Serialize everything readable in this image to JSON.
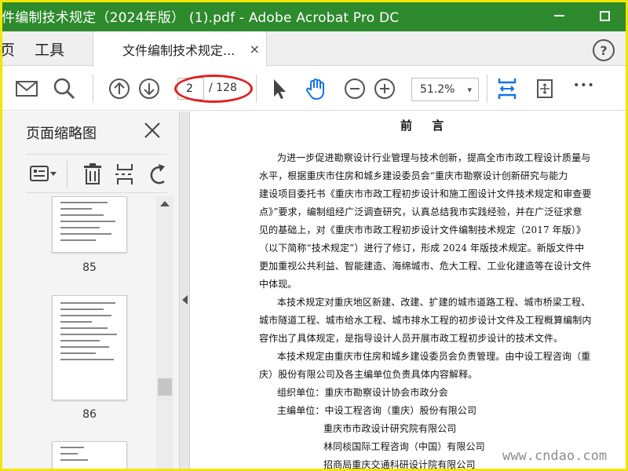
{
  "window": {
    "title": "件编制技术规定（2024年版） (1).pdf - Adobe Acrobat Pro DC"
  },
  "tabs": {
    "home": "页",
    "tools": "工具",
    "document": "文件编制技术规定...",
    "close": "×"
  },
  "toolbar": {
    "page_current": "2",
    "page_total": "/ 128",
    "zoom": "51.2%",
    "zoom_arrow": "▾",
    "more": "•••"
  },
  "thumbnail_pane": {
    "title": "页面缩略图",
    "pages": [
      "85",
      "86"
    ]
  },
  "document": {
    "heading": "前 言",
    "lines": [
      "为进一步促进勘察设计行业管理与技术创新，提高全市市政工程设计质量与",
      "水平，根据重庆市住房和城乡建设委员会“重庆市勘察设计创新研究与能力",
      "建设项目委托书《重庆市市政工程初步设计和施工图设计文件技术规定和审查要",
      "点》”要求，编制组经广泛调查研究，认真总结我市实践经验，并在广泛征求意",
      "见的基础上，对《重庆市市政工程初步设计文件编制技术规定（2017 年版）》",
      "（以下简称“技术规定”）进行了修订，形成 2024 年版技术规定。新版文件中",
      "更加重视公共利益、智能建造、海绵城市、危大工程、工业化建造等在设计文件",
      "中体现。",
      "本技术规定对重庆地区新建、改建、扩建的城市道路工程、城市桥梁工程、",
      "城市隧道工程、城市给水工程、城市排水工程的初步设计文件及工程概算编制内",
      "容作出了具体规定，是指导设计人员开展市政工程初步设计的技术文件。",
      "本技术规定由重庆市住房和城乡建设委员会负责管理。由中设工程咨询（重",
      "庆）股份有限公司及各主编单位负责具体内容解释。",
      "组织单位：重庆市勘察设计协会市政分会",
      "主编单位：中设工程咨询（重庆）股份有限公司",
      "重庆市市政设计研究院有限公司",
      "林同棪国际工程咨询（中国）有限公司",
      "招商局重庆交通科研设计院有限公司"
    ]
  },
  "watermark": "www.cndao.com",
  "colors": {
    "titlebar": "#2d8a2d",
    "frame": "#f2e600",
    "accent_blue": "#1473e6",
    "annotation_red": "#e02020"
  }
}
